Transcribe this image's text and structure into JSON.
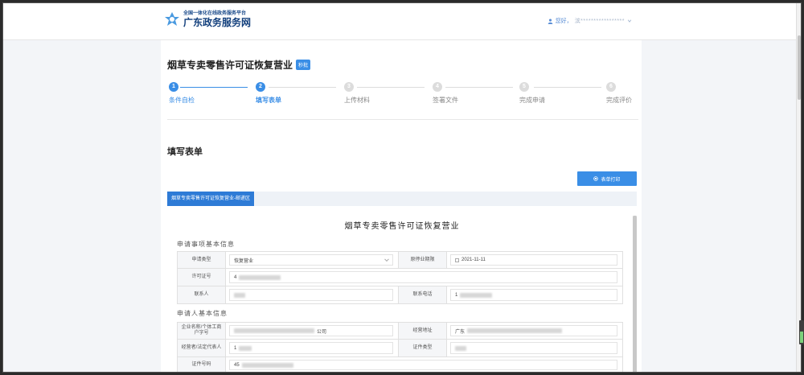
{
  "header": {
    "logo_small": "全国一体化在线政务服务平台",
    "logo_big": "广东政务服务网",
    "greeting": "您好，",
    "user_masked": "滨*****************"
  },
  "page": {
    "title": "烟草专卖零售许可证恢复营业",
    "badge": "秒批"
  },
  "steps": [
    {
      "num": "1",
      "label": "条件自检"
    },
    {
      "num": "2",
      "label": "填写表单"
    },
    {
      "num": "3",
      "label": "上传材料"
    },
    {
      "num": "4",
      "label": "签署文件"
    },
    {
      "num": "5",
      "label": "完成申请"
    },
    {
      "num": "6",
      "label": "完成评价"
    }
  ],
  "form_section": {
    "title": "填写表单",
    "print_label": "表单打印",
    "tab_label": "烟草专卖零售许可证恢复营业-邮递区"
  },
  "form": {
    "title": "烟草专卖零售许可证恢复营业",
    "group1": "申请事项基本信息",
    "group2": "申请人基本信息",
    "apply_type_label": "申请类型",
    "apply_type_value": "恢复营业",
    "orig_deadline_label": "原停业期限",
    "orig_deadline_value": "2021-11-11",
    "license_label": "许可证号",
    "license_value": "4",
    "contact_label": "联系人",
    "phone_label": "联系电话",
    "phone_value": "1",
    "company_label": "企业名称/个体工商户字号",
    "company_value": "公司",
    "address_label": "经营地址",
    "address_value": "广东",
    "legal_label": "经营者/法定代表人",
    "legal_value": "1",
    "cert_type_label": "证件类型",
    "cert_no_label": "证件号码",
    "cert_no_value": "45"
  }
}
